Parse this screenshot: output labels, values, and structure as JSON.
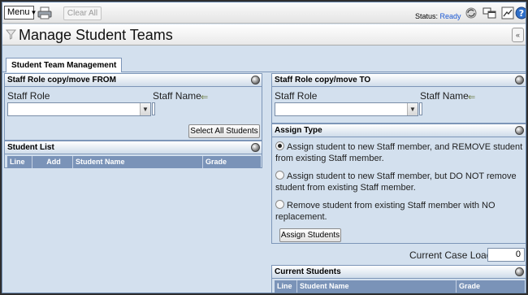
{
  "toolbar": {
    "menu_label": "Menu",
    "clear_all_label": "Clear All",
    "status_label": "Status:",
    "status_value": "Ready",
    "status_color": "#1b58d4"
  },
  "page": {
    "title": "Manage Student Teams"
  },
  "tab": {
    "label": "Student Team Management"
  },
  "from_panel": {
    "title": "Staff Role copy/move FROM",
    "staff_role_label": "Staff Role",
    "staff_name_label": "Staff Name",
    "staff_role_value": "",
    "select_all_label": "Select All Students"
  },
  "student_list": {
    "title": "Student List",
    "columns": [
      "Line",
      "Add",
      "Student Name",
      "Grade"
    ]
  },
  "to_panel": {
    "title": "Staff Role copy/move TO",
    "staff_role_label": "Staff Role",
    "staff_name_label": "Staff Name",
    "staff_role_value": ""
  },
  "assign_type": {
    "title": "Assign Type",
    "options": [
      {
        "label": "Assign student to new Staff member, and REMOVE student from existing Staff member.",
        "checked": true
      },
      {
        "label": "Assign student to new Staff member, but DO NOT remove student from existing Staff member.",
        "checked": false
      },
      {
        "label": "Remove student from existing Staff member with NO replacement.",
        "checked": false
      }
    ],
    "assign_button_label": "Assign Students"
  },
  "caseload": {
    "label": "Current Case Load",
    "value": "0"
  },
  "current_students": {
    "title": "Current Students",
    "columns": [
      "Line",
      "Student Name",
      "Grade"
    ]
  }
}
